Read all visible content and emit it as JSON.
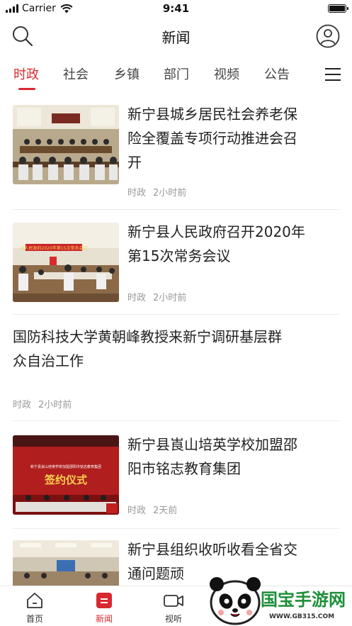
{
  "status_bar": {
    "carrier": "Carrier",
    "time": "9:41"
  },
  "header": {
    "title": "新闻"
  },
  "tabs": [
    {
      "label": "时政",
      "active": true
    },
    {
      "label": "社会"
    },
    {
      "label": "乡镇"
    },
    {
      "label": "部门"
    },
    {
      "label": "视频"
    },
    {
      "label": "公告"
    }
  ],
  "news": [
    {
      "title_lines": [
        "新宁县城乡居民社会养老保",
        "险全覆盖专项行动推进会召",
        "开"
      ],
      "category": "时政",
      "time": "2小时前"
    },
    {
      "title_lines": [
        "新宁县人民政府召开2020年",
        "第15次常务会议"
      ],
      "category": "时政",
      "time": "2小时前",
      "photo_banner": "县人民政府2020年第15次常务会议"
    },
    {
      "title_lines": [
        "国防科技大学黄朝峰教授来新宁调研基层群",
        "众自治工作"
      ],
      "category": "时政",
      "time": "2小时前"
    },
    {
      "title_lines": [
        "新宁县崀山培英学校加盟邵",
        "阳市铭志教育集团"
      ],
      "category": "时政",
      "time": "2天前",
      "photo_banner": "新宁县崀山培英学校加盟邵阳市铭志教育集团",
      "photo_sign": "签约仪式"
    },
    {
      "title_lines": [
        "新宁县组织收听收看全省交",
        "通问题顽"
      ]
    }
  ],
  "tabbar": [
    {
      "label": "首页",
      "icon": "home-icon"
    },
    {
      "label": "新闻",
      "icon": "news-icon",
      "active": true
    },
    {
      "label": "视听",
      "icon": "video-icon"
    }
  ],
  "watermark": {
    "brand": "国宝手游网",
    "url": "WWW.GB315.COM"
  },
  "colors": {
    "accent": "#d9282f",
    "text": "#222222",
    "meta": "#999999"
  }
}
